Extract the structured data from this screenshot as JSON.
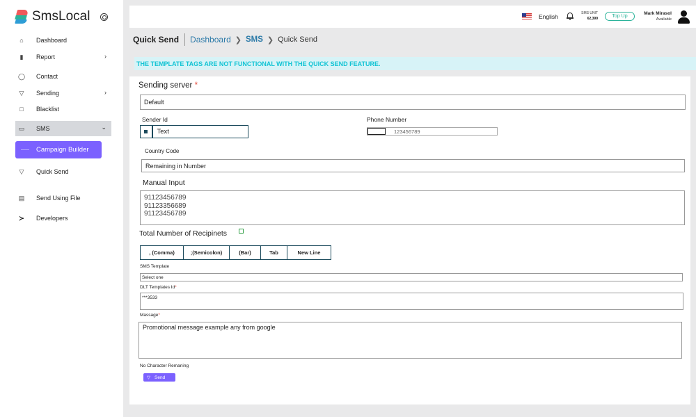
{
  "brand": {
    "name": "SmsLocal"
  },
  "sidebar": {
    "items": [
      {
        "label": "Dashboard",
        "icon": "home-icon",
        "glyph": "⌂"
      },
      {
        "label": "Report",
        "icon": "bar-chart-icon",
        "glyph": "▮"
      },
      {
        "label": "Contact",
        "icon": "user-icon",
        "glyph": "◯"
      },
      {
        "label": "Sending",
        "icon": "send-icon",
        "glyph": "▽"
      },
      {
        "label": "Blacklist",
        "icon": "blacklist-icon",
        "glyph": "□"
      },
      {
        "label": "SMS",
        "icon": "message-icon",
        "glyph": "▭"
      },
      {
        "label": "Campaign Builder"
      },
      {
        "label": "Quick Send",
        "icon": "send-icon",
        "glyph": "▽"
      },
      {
        "label": "Send Using File",
        "icon": "file-icon",
        "glyph": "▤"
      },
      {
        "label": "Developers",
        "icon": "terminal-icon",
        "glyph": "≻"
      }
    ],
    "chevron_right": "›",
    "chevron_down": "⌄"
  },
  "topbar": {
    "language": "English",
    "sms_unit_label": "SMS UNIT",
    "sms_unit_value": "62,399",
    "topup_label": "Top Up",
    "user_name": "Mark Mirasol",
    "user_status": "Available"
  },
  "breadcrumb": {
    "title": "Quick Send",
    "items": [
      "Dashboard",
      "SMS",
      "Quick Send"
    ],
    "arrow": "❯"
  },
  "alert": {
    "text": "THE TEMPLATE TAGS ARE NOT FUNCTIONAL WITH THE QUICK SEND FEATURE."
  },
  "form": {
    "sending_server_label": "Sending server",
    "required_mark": "*",
    "sending_server_value": "Default",
    "sender_id_label": "Sender Id",
    "sender_id_value": "Text",
    "phone_number_label": "Phone Number",
    "phone_number_placeholder": "123456789",
    "country_code_label": "Country Code",
    "country_code_value": "Remaining in Number",
    "manual_input_label": "Manual Input",
    "manual_input_value": "91123456789\n91123356689\n91123456789",
    "total_recipients_label": "Total Number of Recipinets",
    "separators": [
      ", (Comma)",
      ";(Semicolon)",
      "(Bar)",
      "Tab",
      "New Line"
    ],
    "sms_template_label": "SMS Template",
    "sms_template_value": "Select one",
    "dlt_label": "DLT Templates Id",
    "dlt_value": "***3533",
    "message_label": "Massage",
    "message_value": "Promotional message example any from google",
    "char_remaining": "No Character Remaning",
    "send_label": "Send"
  },
  "colors": {
    "accent": "#7b61ff",
    "teal": "#2bb39a",
    "alert_text": "#12c4d4",
    "alert_bg": "#d7f3f7",
    "link": "#2c7aa8"
  }
}
